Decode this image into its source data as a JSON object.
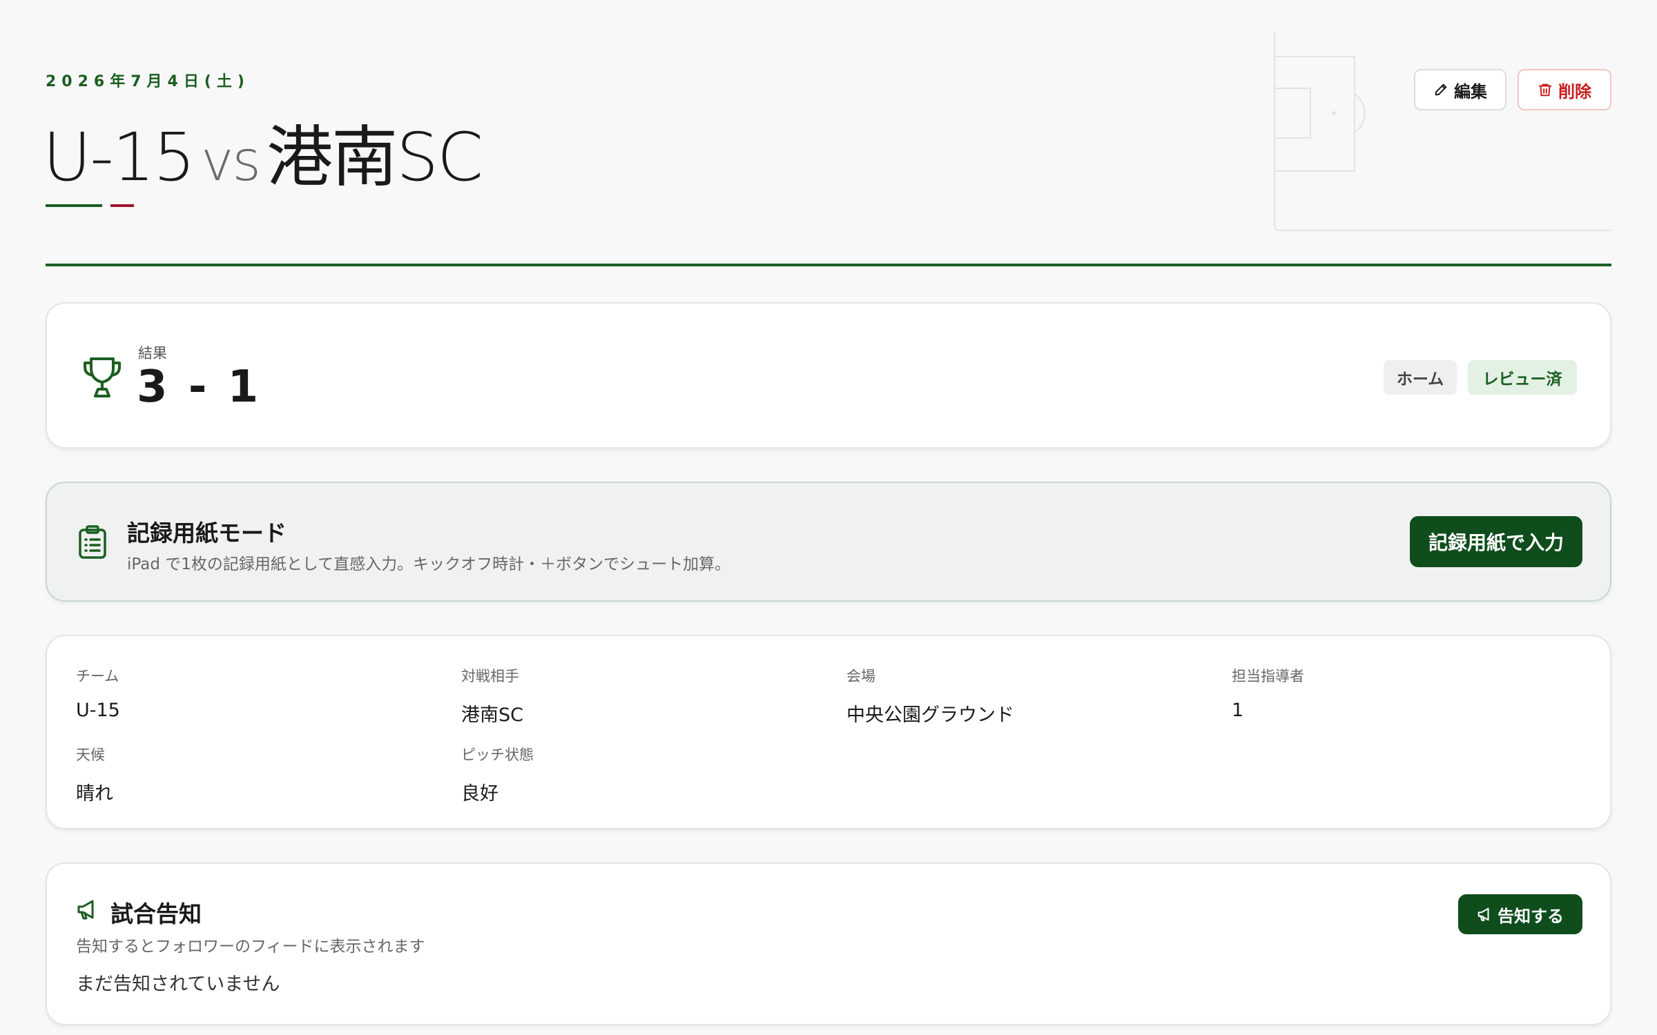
{
  "header": {
    "date": "2026年7月4日(土)",
    "team": "U-15",
    "vs": "vs",
    "opponent": "港南SC",
    "edit_label": "編集",
    "delete_label": "削除"
  },
  "result": {
    "label": "結果",
    "score": "3 - 1",
    "badges": [
      "ホーム",
      "レビュー済"
    ]
  },
  "record_sheet": {
    "title": "記録用紙モード",
    "description": "iPad で1枚の記録用紙として直感入力。キックオフ時計・＋ボタンでシュート加算。",
    "button_label": "記録用紙で入力"
  },
  "info": {
    "items": [
      {
        "label": "チーム",
        "value": "U-15"
      },
      {
        "label": "対戦相手",
        "value": "港南SC"
      },
      {
        "label": "会場",
        "value": "中央公園グラウンド"
      },
      {
        "label": "担当指導者",
        "value": "1"
      },
      {
        "label": "天候",
        "value": "晴れ"
      },
      {
        "label": "ピッチ状態",
        "value": "良好"
      }
    ]
  },
  "announce": {
    "title": "試合告知",
    "description": "告知するとフォロワーのフィードに表示されます",
    "status": "まだ告知されていません",
    "button_label": "告知する"
  },
  "colors": {
    "brand_green": "#1b5e20",
    "button_green": "#0f4d1c",
    "accent_red": "#a0102b",
    "delete_red": "#c81e1e"
  }
}
